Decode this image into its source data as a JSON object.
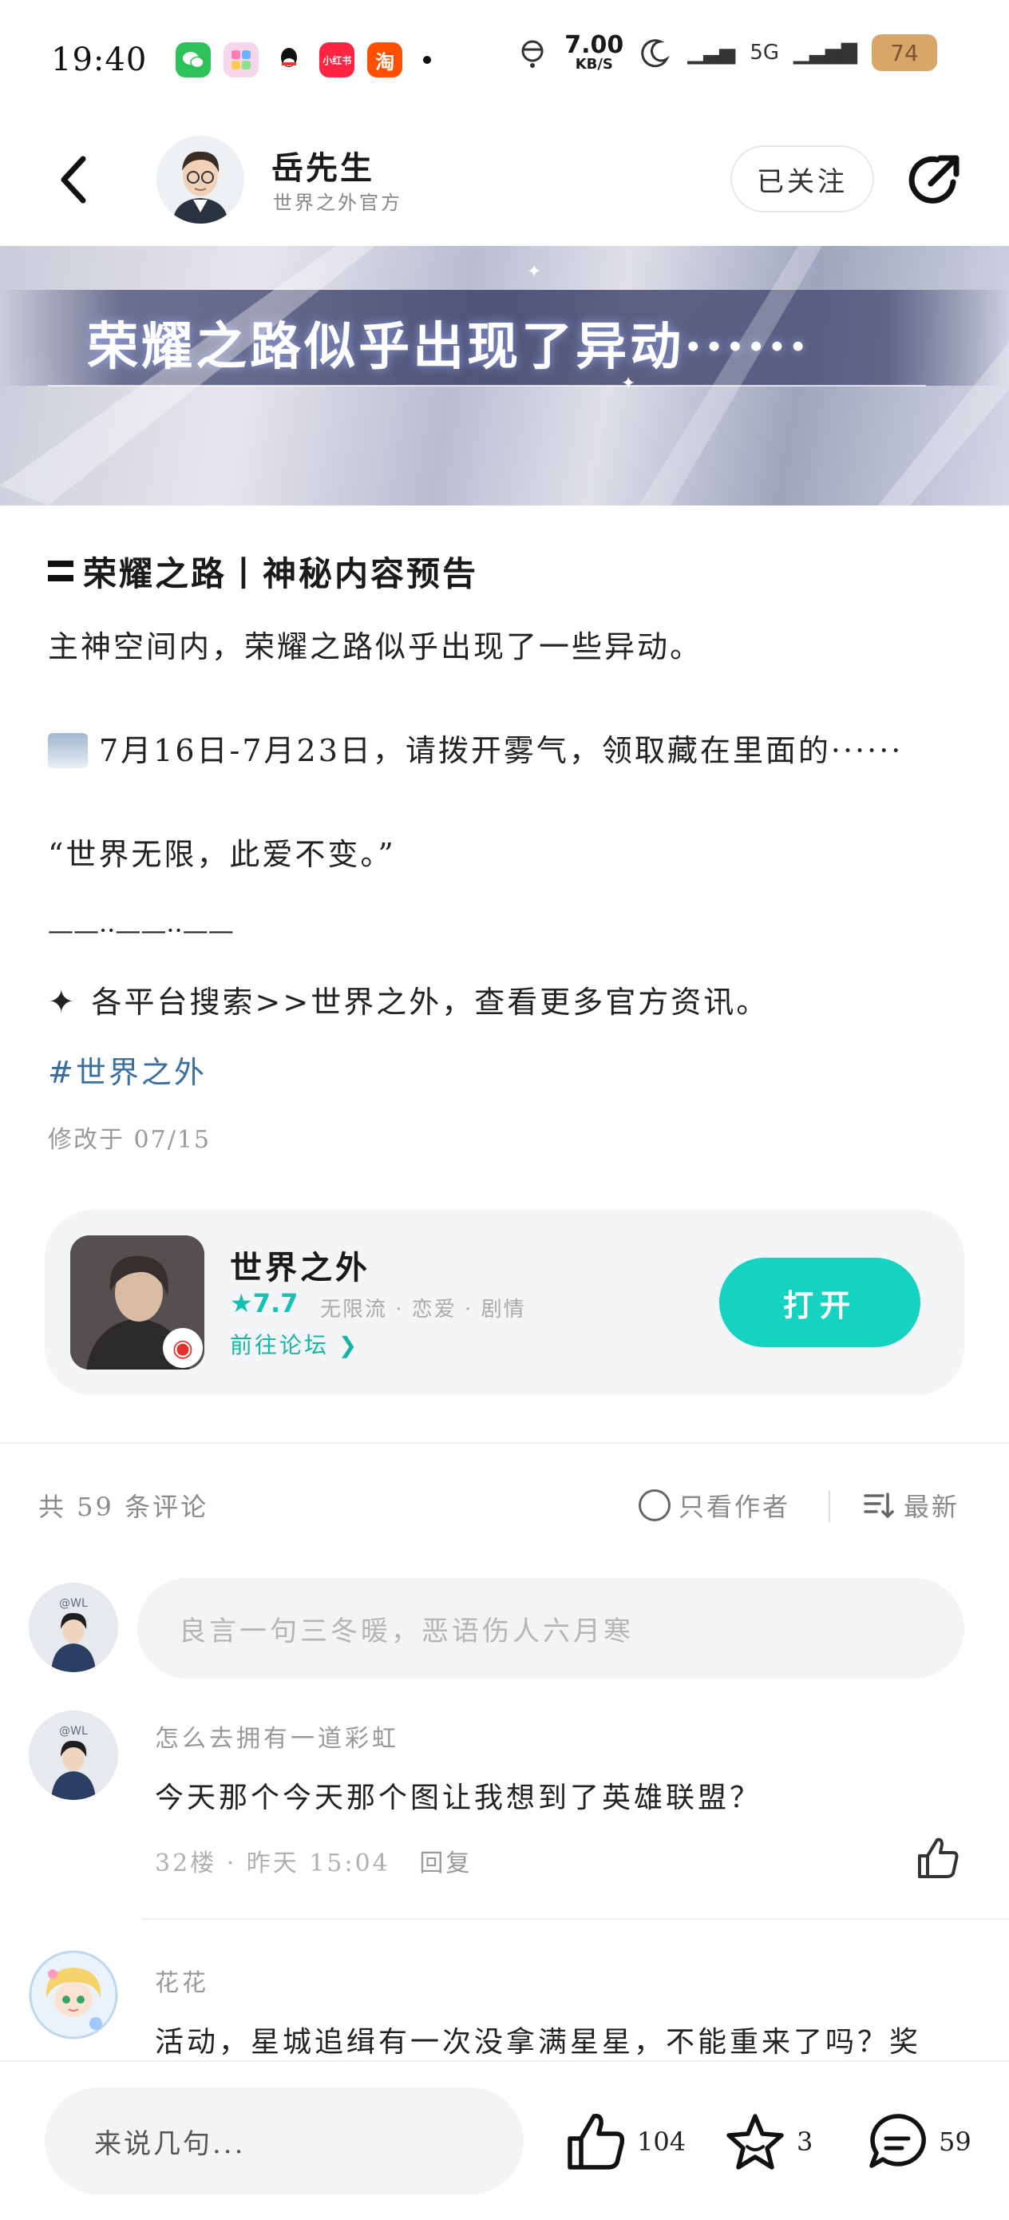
{
  "status_bar": {
    "time": "19:40",
    "apps": [
      {
        "name": "wechat-icon",
        "label": "",
        "color": "#2dc35a"
      },
      {
        "name": "app-icon",
        "label": "",
        "color": "#f4b2d8"
      },
      {
        "name": "qq-icon",
        "label": "",
        "color": "#111111"
      },
      {
        "name": "xiaohongshu-icon",
        "label": "小红书",
        "color": "#ff2442"
      },
      {
        "name": "taobao-icon",
        "label": "淘",
        "color": "#ff5000"
      }
    ],
    "net_speed": "7.00",
    "net_unit": "KB/S",
    "signal": "5G",
    "battery": "74"
  },
  "header": {
    "author_name": "岳先生",
    "author_subtitle": "世界之外官方",
    "follow_label": "已关注"
  },
  "banner": {
    "text": "荣耀之路似乎出现了异动······"
  },
  "post": {
    "title": "荣耀之路丨神秘内容预告",
    "p1": "主神空间内，荣耀之路似乎出现了一些异动。",
    "p2": "7月16日-7月23日，请拨开雾气，领取藏在里面的······",
    "p3": "“世界无限，此爱不变。”",
    "p4": "——··——··——",
    "p5": "各平台搜索>>世界之外，查看更多官方资讯。",
    "hashtag": "#世界之外",
    "edited": "修改于 07/15"
  },
  "game_card": {
    "name": "世界之外",
    "rating": "7.7",
    "tags": "无限流 · 恋爱 · 剧情",
    "forum_link": "前往论坛",
    "open_label": "打开",
    "accent": "#16d2c1"
  },
  "comments_bar": {
    "count": "共 59 条评论",
    "author_only": "只看作者",
    "sort": "最新"
  },
  "comment_input": {
    "placeholder": "良言一句三冬暖，恶语伤人六月寒"
  },
  "comments": [
    {
      "user": "怎么去拥有一道彩虹",
      "text": "今天那个今天那个图让我想到了英雄联盟？",
      "meta": "32楼 · 昨天 15:04",
      "reply": "回复"
    },
    {
      "user": "花花",
      "text": "活动，星城追缉有一次没拿满星星，不能重来了吗？奖"
    }
  ],
  "bottom_bar": {
    "input_placeholder": "来说几句...",
    "likes": "104",
    "favorites": "3",
    "comments": "59"
  }
}
